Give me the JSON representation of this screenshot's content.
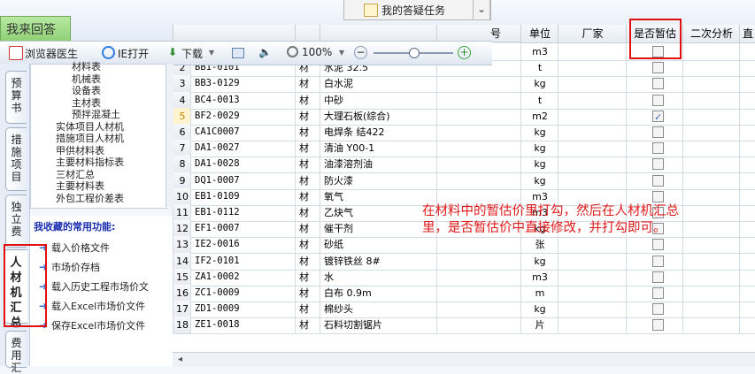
{
  "top": {
    "green_tab_label": "我来回答",
    "popup_label": "我的答疑任务",
    "popup_chevron": "⌄"
  },
  "toolbar": {
    "items": [
      {
        "icon": "browser-doctor-icon",
        "label": "浏览器医生"
      },
      {
        "icon": "ie-icon",
        "label": "IE打开"
      },
      {
        "icon": "download-arrow-icon",
        "label": "下载"
      },
      {
        "icon": "window-icon",
        "label": ""
      },
      {
        "icon": "speaker-icon",
        "label": ""
      },
      {
        "icon": "zoom-icon",
        "label": "100%"
      }
    ],
    "zoom_minus": "−",
    "zoom_plus": "+",
    "zoom_level": 0.5,
    "scroll_chevron": "›"
  },
  "grid": {
    "headers": {
      "code_tail": "号",
      "unit": "单位",
      "maker": "厂家",
      "est": "是否暂估",
      "second": "二次分析",
      "last": "直"
    },
    "rows": [
      {
        "num": "",
        "code": "",
        "type": "",
        "name": "",
        "unit": "m3",
        "est": false
      },
      {
        "num": "2",
        "code": "BB1-0101",
        "type": "材",
        "name": "水泥 32.5",
        "unit": "t",
        "est": false
      },
      {
        "num": "3",
        "code": "BB3-0129",
        "type": "材",
        "name": "白水泥",
        "unit": "kg",
        "est": false
      },
      {
        "num": "4",
        "code": "BC4-0013",
        "type": "材",
        "name": "中砂",
        "unit": "t",
        "est": false
      },
      {
        "num": "5",
        "code": "BF2-0029",
        "type": "材",
        "name": "大理石板(综合)",
        "unit": "m2",
        "est": true
      },
      {
        "num": "6",
        "code": "CA1C0007",
        "type": "材",
        "name": "电焊条 结422",
        "unit": "kg",
        "est": false
      },
      {
        "num": "7",
        "code": "DA1-0027",
        "type": "材",
        "name": "清油 Y00-1",
        "unit": "kg",
        "est": false
      },
      {
        "num": "8",
        "code": "DA1-0028",
        "type": "材",
        "name": "油漆溶剂油",
        "unit": "kg",
        "est": false
      },
      {
        "num": "9",
        "code": "DQ1-0007",
        "type": "材",
        "name": "防火漆",
        "unit": "kg",
        "est": false
      },
      {
        "num": "10",
        "code": "EB1-0109",
        "type": "材",
        "name": "氧气",
        "unit": "m3",
        "est": false
      },
      {
        "num": "11",
        "code": "EB1-0112",
        "type": "材",
        "name": "乙炔气",
        "unit": "m3",
        "est": false
      },
      {
        "num": "12",
        "code": "EF1-0007",
        "type": "材",
        "name": "催干剂",
        "unit": "kg",
        "est": false
      },
      {
        "num": "13",
        "code": "IE2-0016",
        "type": "材",
        "name": "砂纸",
        "unit": "张",
        "est": false
      },
      {
        "num": "14",
        "code": "IF2-0101",
        "type": "材",
        "name": "镀锌铁丝 8#",
        "unit": "kg",
        "est": false
      },
      {
        "num": "15",
        "code": "ZA1-0002",
        "type": "材",
        "name": "水",
        "unit": "m3",
        "est": false
      },
      {
        "num": "16",
        "code": "ZC1-0009",
        "type": "材",
        "name": "白布 0.9m",
        "unit": "m",
        "est": false
      },
      {
        "num": "17",
        "code": "ZD1-0009",
        "type": "材",
        "name": "棉纱头",
        "unit": "kg",
        "est": false
      },
      {
        "num": "18",
        "code": "ZE1-0018",
        "type": "材",
        "name": "石料切割锯片",
        "unit": "片",
        "est": false
      }
    ]
  },
  "vtabs": {
    "budget": "预算书",
    "measures": "措施项目",
    "independent": "独立费",
    "labor": "人材机汇总",
    "fee": "费用汇"
  },
  "tree": {
    "items": [
      {
        "label": "材料表"
      },
      {
        "label": "机械表"
      },
      {
        "label": "设备表"
      },
      {
        "label": "主材表"
      },
      {
        "label": "预拌混凝土"
      },
      {
        "label": "实体项目人材机"
      },
      {
        "label": "措施项目人材机"
      },
      {
        "label": "甲供材料表"
      },
      {
        "label": "主要材料指标表"
      },
      {
        "label": "三材汇总"
      },
      {
        "label": "主要材料表"
      },
      {
        "label": "外包工程价差表"
      }
    ]
  },
  "fav": {
    "title": "我收藏的常用功能:",
    "items": [
      {
        "label": "载入价格文件"
      },
      {
        "label": "市场价存档"
      },
      {
        "label": "载入历史工程市场价文"
      },
      {
        "label": "载入Excel市场价文件"
      },
      {
        "label": "保存Excel市场价文件"
      }
    ]
  },
  "annotation": {
    "line1": "在材料中的暂估价里打勾，然后在人材机汇总",
    "line2": "里，是否暂估价中直接修改，并打勾即可。"
  },
  "colors": {
    "annotation": "#e01a1a",
    "highlight_box": "#e01010",
    "accent": "#2f6bd8"
  }
}
